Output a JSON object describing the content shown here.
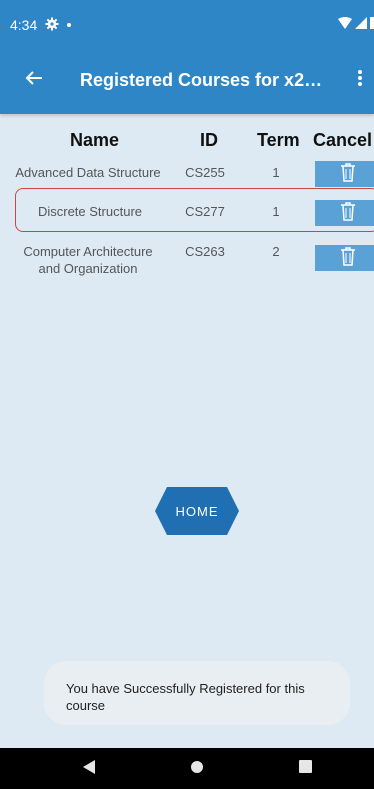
{
  "status_bar": {
    "time": "4:34",
    "icons": [
      "gear-icon",
      "dot-icon",
      "wifi-icon",
      "signal-icon",
      "battery-icon"
    ]
  },
  "app_bar": {
    "title": "Registered Courses for x20...",
    "back_icon": "arrow-left-icon",
    "menu_icon": "more-vert-icon"
  },
  "table": {
    "headers": {
      "name": "Name",
      "id": "ID",
      "term": "Term",
      "cancel": "Cancel"
    },
    "rows": [
      {
        "name_line1": "Advanced Data Structure",
        "name_line2": "",
        "id": "CS255",
        "term": "1",
        "cancel_icon": "trash-icon"
      },
      {
        "name_line1": "Discrete Structure",
        "name_line2": "",
        "id": "CS277",
        "term": "1",
        "cancel_icon": "trash-icon"
      },
      {
        "name_line1": "Computer Architecture",
        "name_line2": "and Organization",
        "id": "CS263",
        "term": "2",
        "cancel_icon": "trash-icon"
      }
    ]
  },
  "home_button": {
    "label": "HOME"
  },
  "toast": {
    "message": "You have Successfully Registered for this course"
  },
  "colors": {
    "primary": "#2f86c6",
    "background": "#ddeaf3",
    "button": "#5aa2d6",
    "highlight_border": "#c94646",
    "home_button": "#1f6fb2"
  }
}
